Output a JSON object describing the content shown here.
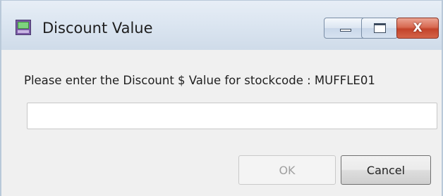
{
  "window": {
    "title": "Discount Value",
    "controls": {
      "minimize": "minimize-icon",
      "maximize": "maximize-icon",
      "close": "X"
    }
  },
  "dialog": {
    "prompt": "Please enter the Discount $ Value for stockcode : MUFFLE01",
    "input_value": "",
    "ok_label": "OK",
    "ok_enabled": false,
    "cancel_label": "Cancel"
  },
  "colors": {
    "close_button": "#c3432a",
    "titlebar": "#dce6f1",
    "dialog_background": "#f0f0f0"
  }
}
